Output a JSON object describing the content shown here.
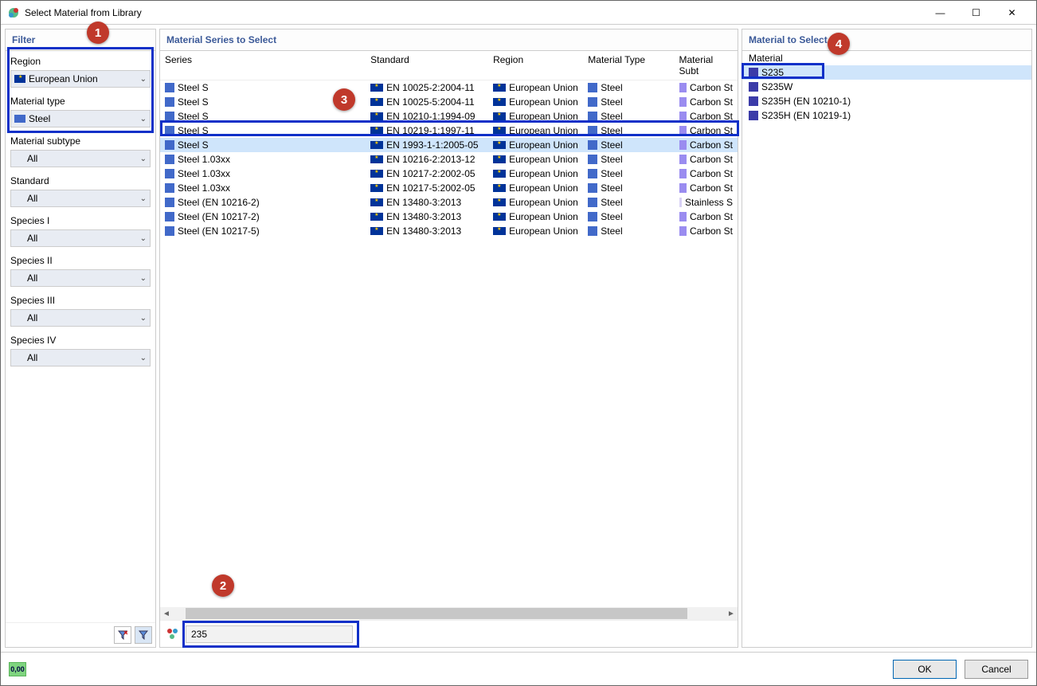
{
  "window": {
    "title": "Select Material from Library"
  },
  "filter": {
    "header": "Filter",
    "region_label": "Region",
    "region_value": "European Union",
    "type_label": "Material type",
    "type_value": "Steel",
    "subtype_label": "Material subtype",
    "subtype_value": "All",
    "standard_label": "Standard",
    "standard_value": "All",
    "species1_label": "Species I",
    "species1_value": "All",
    "species2_label": "Species II",
    "species2_value": "All",
    "species3_label": "Species III",
    "species3_value": "All",
    "species4_label": "Species IV",
    "species4_value": "All"
  },
  "series": {
    "header": "Material Series to Select",
    "cols": {
      "c0": "Series",
      "c1": "Standard",
      "c2": "Region",
      "c3": "Material Type",
      "c4": "Material Subt"
    },
    "rows": [
      {
        "s": "Steel S",
        "std": "EN 10025-2:2004-11",
        "r": "European Union",
        "t": "Steel",
        "sub": "Carbon St",
        "sel": false
      },
      {
        "s": "Steel S",
        "std": "EN 10025-5:2004-11",
        "r": "European Union",
        "t": "Steel",
        "sub": "Carbon St",
        "sel": false
      },
      {
        "s": "Steel S",
        "std": "EN 10210-1:1994-09",
        "r": "European Union",
        "t": "Steel",
        "sub": "Carbon St",
        "sel": false
      },
      {
        "s": "Steel S",
        "std": "EN 10219-1:1997-11",
        "r": "European Union",
        "t": "Steel",
        "sub": "Carbon St",
        "sel": false
      },
      {
        "s": "Steel S",
        "std": "EN 1993-1-1:2005-05",
        "r": "European Union",
        "t": "Steel",
        "sub": "Carbon St",
        "sel": true
      },
      {
        "s": "Steel 1.03xx",
        "std": "EN 10216-2:2013-12",
        "r": "European Union",
        "t": "Steel",
        "sub": "Carbon St",
        "sel": false
      },
      {
        "s": "Steel 1.03xx",
        "std": "EN 10217-2:2002-05",
        "r": "European Union",
        "t": "Steel",
        "sub": "Carbon St",
        "sel": false
      },
      {
        "s": "Steel 1.03xx",
        "std": "EN 10217-5:2002-05",
        "r": "European Union",
        "t": "Steel",
        "sub": "Carbon St",
        "sel": false
      },
      {
        "s": "Steel (EN 10216-2)",
        "std": "EN 13480-3:2013",
        "r": "European Union",
        "t": "Steel",
        "sub": "Stainless S",
        "sel": false,
        "stain": true
      },
      {
        "s": "Steel (EN 10217-2)",
        "std": "EN 13480-3:2013",
        "r": "European Union",
        "t": "Steel",
        "sub": "Carbon St",
        "sel": false
      },
      {
        "s": "Steel (EN 10217-5)",
        "std": "EN 13480-3:2013",
        "r": "European Union",
        "t": "Steel",
        "sub": "Carbon St",
        "sel": false
      }
    ]
  },
  "material": {
    "header": "Material to Select",
    "col": "Material",
    "rows": [
      {
        "name": "S235",
        "sel": true
      },
      {
        "name": "S235W",
        "sel": false
      },
      {
        "name": "S235H (EN 10210-1)",
        "sel": false
      },
      {
        "name": "S235H (EN 10219-1)",
        "sel": false
      }
    ]
  },
  "search": {
    "value": "235"
  },
  "buttons": {
    "ok": "OK",
    "cancel": "Cancel",
    "units": "0,00"
  },
  "callouts": {
    "c1": "1",
    "c2": "2",
    "c3": "3",
    "c4": "4"
  }
}
